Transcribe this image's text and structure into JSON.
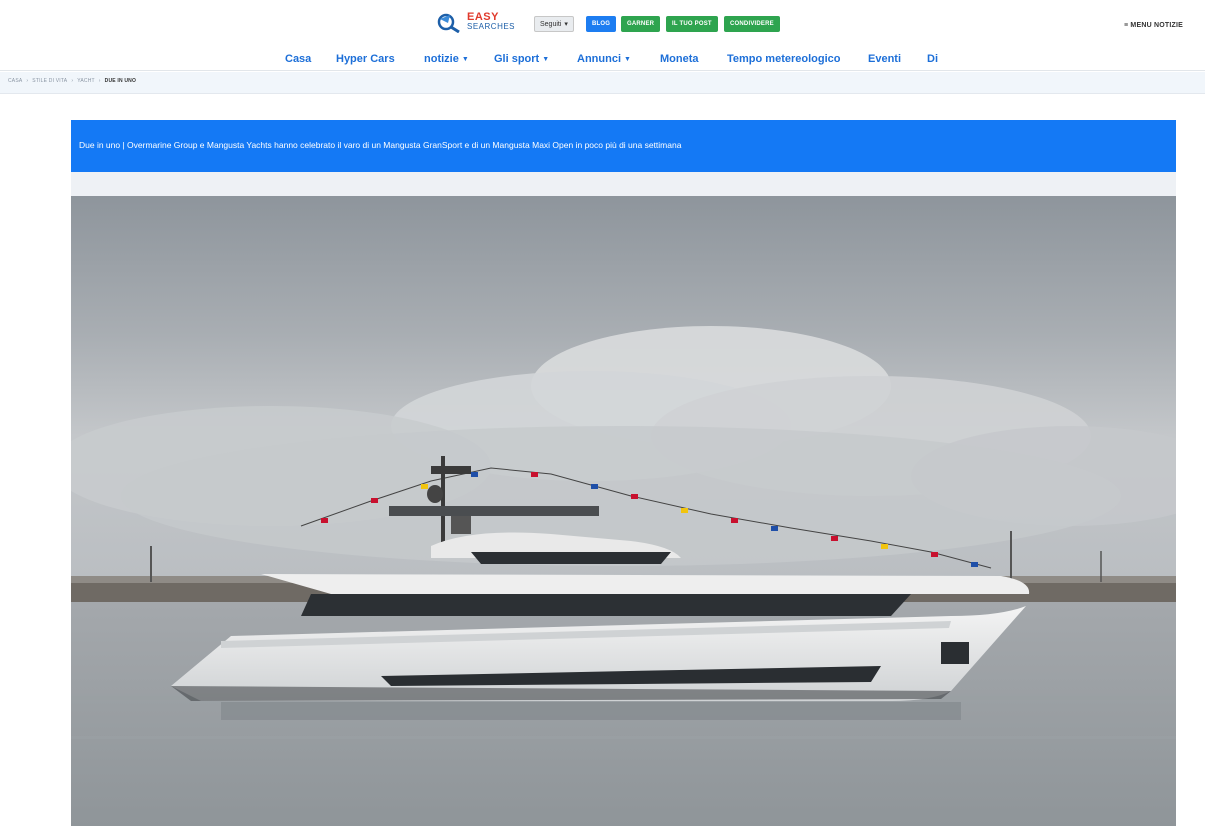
{
  "header": {
    "logo_line1": "EASY",
    "logo_line2": "SEARCHES",
    "language_label": "Seguiti",
    "buttons": [
      "BLOG",
      "GARNER",
      "IL TUO POST",
      "CONDIVIDERE"
    ],
    "menu_label": "≡ MENU NOTIZIE"
  },
  "nav": {
    "items": [
      {
        "label": "Casa",
        "dropdown": false
      },
      {
        "label": "Hyper Cars",
        "dropdown": false
      },
      {
        "label": "notizie",
        "dropdown": true
      },
      {
        "label": "Gli sport",
        "dropdown": true
      },
      {
        "label": "Annunci",
        "dropdown": true
      },
      {
        "label": "Moneta",
        "dropdown": false
      },
      {
        "label": "Tempo metereologico",
        "dropdown": false
      },
      {
        "label": "Eventi",
        "dropdown": false
      },
      {
        "label": "Di",
        "dropdown": false
      }
    ]
  },
  "breadcrumb": {
    "items": [
      "CASA",
      "STILE DI VITA",
      "YACHT",
      "DUE IN UNO"
    ]
  },
  "article": {
    "title": "Due in uno | Overmarine Group e Mangusta Yachts hanno celebrato il varo di un Mangusta GranSport e di un Mangusta Maxi Open in poco più di una settimana"
  },
  "colors": {
    "accent": "#1479f5",
    "nav_link": "#1d6fd8",
    "green_button": "#2ea44f"
  },
  "photo": {
    "subject": "yacht-photo"
  }
}
